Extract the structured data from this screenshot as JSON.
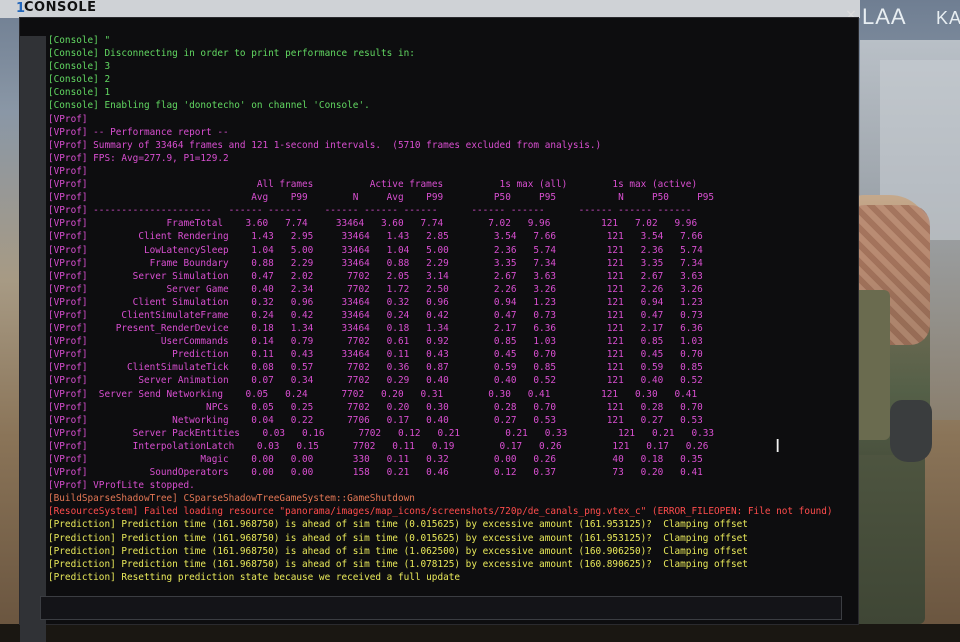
{
  "window": {
    "title": "CONSOLE",
    "close_glyph": "×"
  },
  "hud": {
    "text_left": "LAA",
    "text_right": "KA"
  },
  "log_lines": [
    {
      "tag": "[Console]",
      "text": " \"",
      "style": "console"
    },
    {
      "tag": "[Console]",
      "text": " Disconnecting in order to print performance results in:",
      "style": "console"
    },
    {
      "tag": "[Console]",
      "text": " 3",
      "style": "console"
    },
    {
      "tag": "[Console]",
      "text": " 2",
      "style": "console"
    },
    {
      "tag": "[Console]",
      "text": " 1",
      "style": "console"
    },
    {
      "tag": "[Console]",
      "text": " Enabling flag 'donotecho' on channel 'Console'.",
      "style": "console"
    },
    {
      "tag": "[VProf]",
      "text": "",
      "style": "vprof"
    },
    {
      "tag": "[VProf]",
      "text": " -- Performance report --",
      "style": "vprof"
    },
    {
      "tag": "[VProf]",
      "text": " Summary of 33464 frames and 121 1-second intervals.  (5710 frames excluded from analysis.)",
      "style": "vprof"
    },
    {
      "tag": "[VProf]",
      "text": " FPS: Avg=277.9, P1=129.2",
      "style": "vprof"
    },
    {
      "tag": "[VProf]",
      "text": "",
      "style": "vprof"
    },
    {
      "tag": "[VProf]",
      "text": "                              All frames          Active frames          1s max (all)        1s max (active)",
      "style": "vprof"
    },
    {
      "tag": "[VProf]",
      "text": "                             Avg    P99        N     Avg    P99         P50     P95           N     P50     P95",
      "style": "vprof"
    },
    {
      "tag": "[VProf]",
      "text": " ---------------------   ------ ------    ------ ------ ------      ------ ------      ------ ------ ------",
      "style": "vprof"
    },
    {
      "tag": "[VProf]",
      "text": "              FrameTotal    3.60   7.74     33464   3.60   7.74        7.02   9.96         121   7.02   9.96",
      "style": "vprof"
    },
    {
      "tag": "[VProf]",
      "text": "         Client Rendering    1.43   2.95     33464   1.43   2.85        3.54   7.66         121   3.54   7.66",
      "style": "vprof"
    },
    {
      "tag": "[VProf]",
      "text": "          LowLatencySleep    1.04   5.00     33464   1.04   5.00        2.36   5.74         121   2.36   5.74",
      "style": "vprof"
    },
    {
      "tag": "[VProf]",
      "text": "           Frame Boundary    0.88   2.29     33464   0.88   2.29        3.35   7.34         121   3.35   7.34",
      "style": "vprof"
    },
    {
      "tag": "[VProf]",
      "text": "        Server Simulation    0.47   2.02      7702   2.05   3.14        2.67   3.63         121   2.67   3.63",
      "style": "vprof"
    },
    {
      "tag": "[VProf]",
      "text": "              Server Game    0.40   2.34      7702   1.72   2.50        2.26   3.26         121   2.26   3.26",
      "style": "vprof"
    },
    {
      "tag": "[VProf]",
      "text": "        Client Simulation    0.32   0.96     33464   0.32   0.96        0.94   1.23         121   0.94   1.23",
      "style": "vprof"
    },
    {
      "tag": "[VProf]",
      "text": "      ClientSimulateFrame    0.24   0.42     33464   0.24   0.42        0.47   0.73         121   0.47   0.73",
      "style": "vprof"
    },
    {
      "tag": "[VProf]",
      "text": "     Present_RenderDevice    0.18   1.34     33464   0.18   1.34        2.17   6.36         121   2.17   6.36",
      "style": "vprof"
    },
    {
      "tag": "[VProf]",
      "text": "             UserCommands    0.14   0.79      7702   0.61   0.92        0.85   1.03         121   0.85   1.03",
      "style": "vprof"
    },
    {
      "tag": "[VProf]",
      "text": "               Prediction    0.11   0.43     33464   0.11   0.43        0.45   0.70         121   0.45   0.70",
      "style": "vprof"
    },
    {
      "tag": "[VProf]",
      "text": "       ClientSimulateTick    0.08   0.57      7702   0.36   0.87        0.59   0.85         121   0.59   0.85",
      "style": "vprof"
    },
    {
      "tag": "[VProf]",
      "text": "         Server Animation    0.07   0.34      7702   0.29   0.40        0.40   0.52         121   0.40   0.52",
      "style": "vprof"
    },
    {
      "tag": "[VProf]",
      "text": "  Server Send Networking    0.05   0.24      7702   0.20   0.31        0.30   0.41         121   0.30   0.41",
      "style": "vprof"
    },
    {
      "tag": "[VProf]",
      "text": "                     NPCs    0.05   0.25      7702   0.20   0.30        0.28   0.70         121   0.28   0.70",
      "style": "vprof"
    },
    {
      "tag": "[VProf]",
      "text": "               Networking    0.04   0.22      7706   0.17   0.40        0.27   0.53         121   0.27   0.53",
      "style": "vprof"
    },
    {
      "tag": "[VProf]",
      "text": "        Server PackEntities    0.03   0.16      7702   0.12   0.21        0.21   0.33         121   0.21   0.33",
      "style": "vprof"
    },
    {
      "tag": "[VProf]",
      "text": "        InterpolationLatch    0.03   0.15      7702   0.11   0.19        0.17   0.26         121   0.17   0.26",
      "style": "vprof"
    },
    {
      "tag": "[VProf]",
      "text": "                    Magic    0.00   0.00       330   0.11   0.32        0.00   0.26          40   0.18   0.35",
      "style": "vprof"
    },
    {
      "tag": "[VProf]",
      "text": "           SoundOperators    0.00   0.00       158   0.21   0.46        0.12   0.37          73   0.20   0.41",
      "style": "vprof"
    },
    {
      "tag": "[VProf]",
      "text": " VProfLite stopped.",
      "style": "vprof"
    },
    {
      "tag": "[BuildSparseShadowTree]",
      "text": " CSparseShadowTreeGameSystem::GameShutdown",
      "style": "build"
    },
    {
      "tag": "[ResourceSystem]",
      "text": " Failed loading resource \"panorama/images/map_icons/screenshots/720p/de_canals_png.vtex_c\" (ERROR_FILEOPEN: File not found)",
      "style": "error"
    },
    {
      "tag": "[Prediction]",
      "text": " Prediction time (161.968750) is ahead of sim time (0.015625) by excessive amount (161.953125)?  Clamping offset",
      "style": "pred"
    },
    {
      "tag": "[Prediction]",
      "text": " Prediction time (161.968750) is ahead of sim time (0.015625) by excessive amount (161.953125)?  Clamping offset",
      "style": "pred"
    },
    {
      "tag": "[Prediction]",
      "text": " Prediction time (161.968750) is ahead of sim time (1.062500) by excessive amount (160.906250)?  Clamping offset",
      "style": "pred"
    },
    {
      "tag": "[Prediction]",
      "text": " Prediction time (161.968750) is ahead of sim time (1.078125) by excessive amount (160.890625)?  Clamping offset",
      "style": "pred"
    },
    {
      "tag": "[Prediction]",
      "text": " Resetting prediction state because we received a full update",
      "style": "pred"
    }
  ],
  "colors": {
    "console": "#62d862",
    "vprof": "#d94fd1",
    "build": "#e47755",
    "error": "#ff4c4c",
    "pred": "#e9e95a"
  }
}
